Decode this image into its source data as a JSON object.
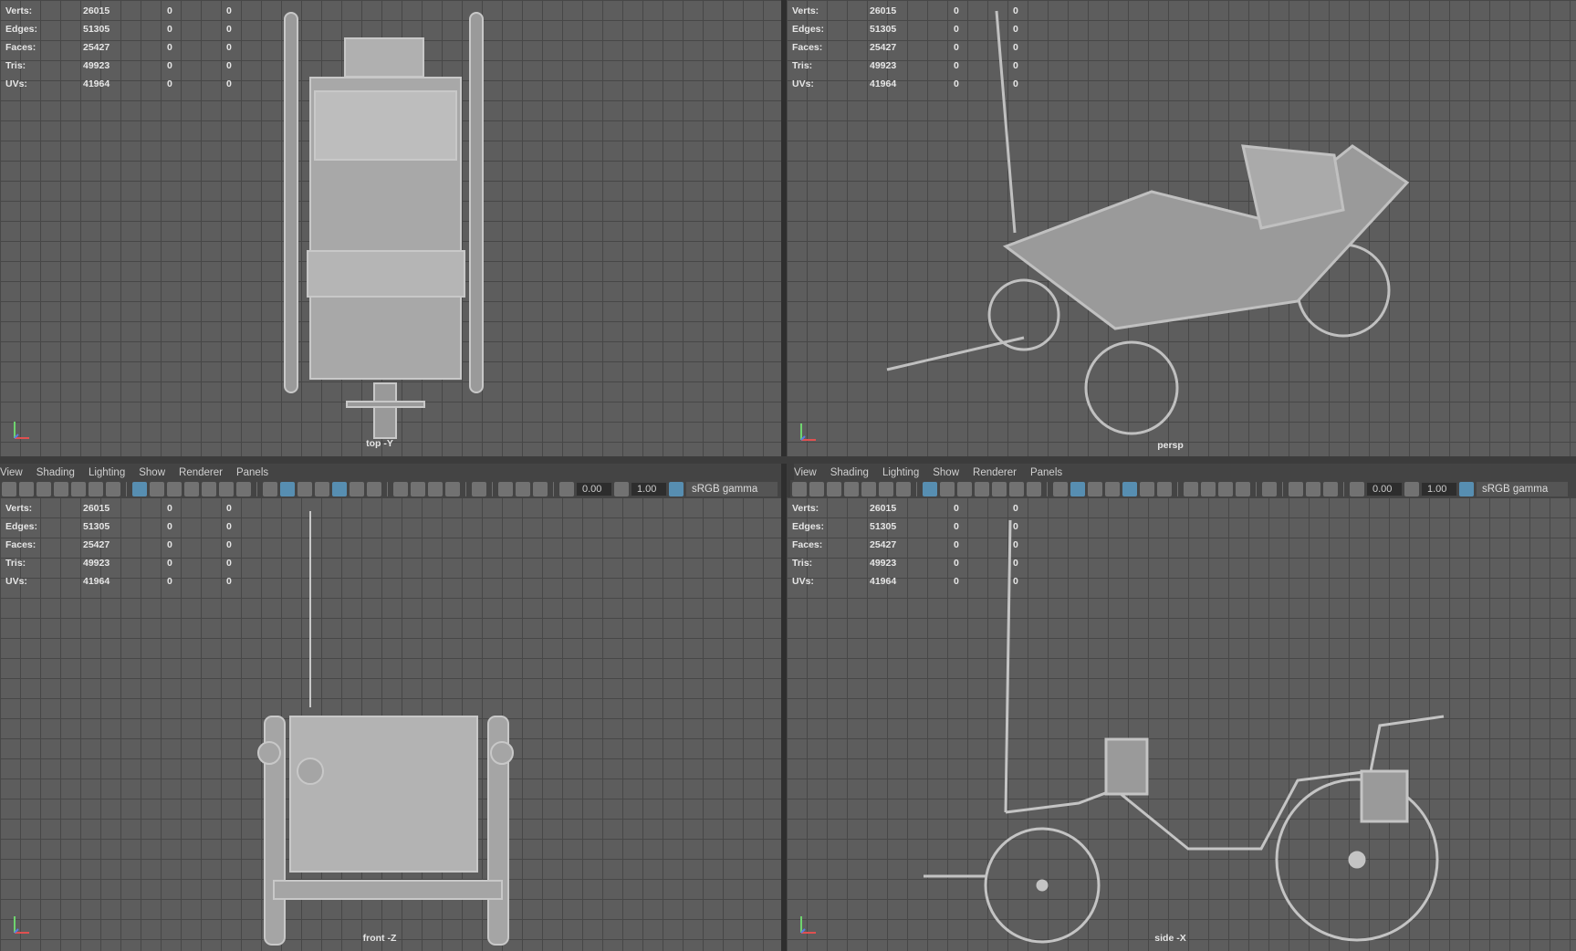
{
  "hud": {
    "labels": [
      "Verts:",
      "Edges:",
      "Faces:",
      "Tris:",
      "UVs:"
    ],
    "values": [
      "26015",
      "51305",
      "25427",
      "49923",
      "41964"
    ],
    "sel": "0",
    "comp": "0"
  },
  "panes": {
    "top": "top -Y",
    "persp": "persp",
    "front": "front -Z",
    "side": "side -X"
  },
  "menu": [
    "View",
    "Shading",
    "Lighting",
    "Show",
    "Renderer",
    "Panels"
  ],
  "toolbar": {
    "exposure": "0.00",
    "gamma": "1.00",
    "colorspace": "sRGB gamma",
    "icons": [
      "camera-select-icon",
      "camera-lock-icon",
      "camera-attributes-icon",
      "bookmark-icon",
      "image-plane-icon",
      "2d-pan-zoom-icon",
      "grease-pencil-icon",
      "sep",
      "grid-icon",
      "film-gate-icon",
      "resolution-gate-icon",
      "gate-mask-icon",
      "field-chart-icon",
      "safe-action-icon",
      "safe-title-icon",
      "sep",
      "wireframe-icon",
      "smooth-shade-icon",
      "default-material-icon",
      "wireframe-on-shaded-icon",
      "xray-icon",
      "lights-icon",
      "shadows-icon",
      "sep",
      "screen-space-ao-icon",
      "motion-blur-icon",
      "anti-aliasing-icon",
      "depth-of-field-icon",
      "sep",
      "isolate-select-icon",
      "sep",
      "xray-joints-icon",
      "xray-active-icon",
      "backface-culling-icon",
      "sep",
      "exposure-icon"
    ],
    "active": [
      "grid-icon",
      "smooth-shade-icon",
      "xray-icon"
    ]
  }
}
